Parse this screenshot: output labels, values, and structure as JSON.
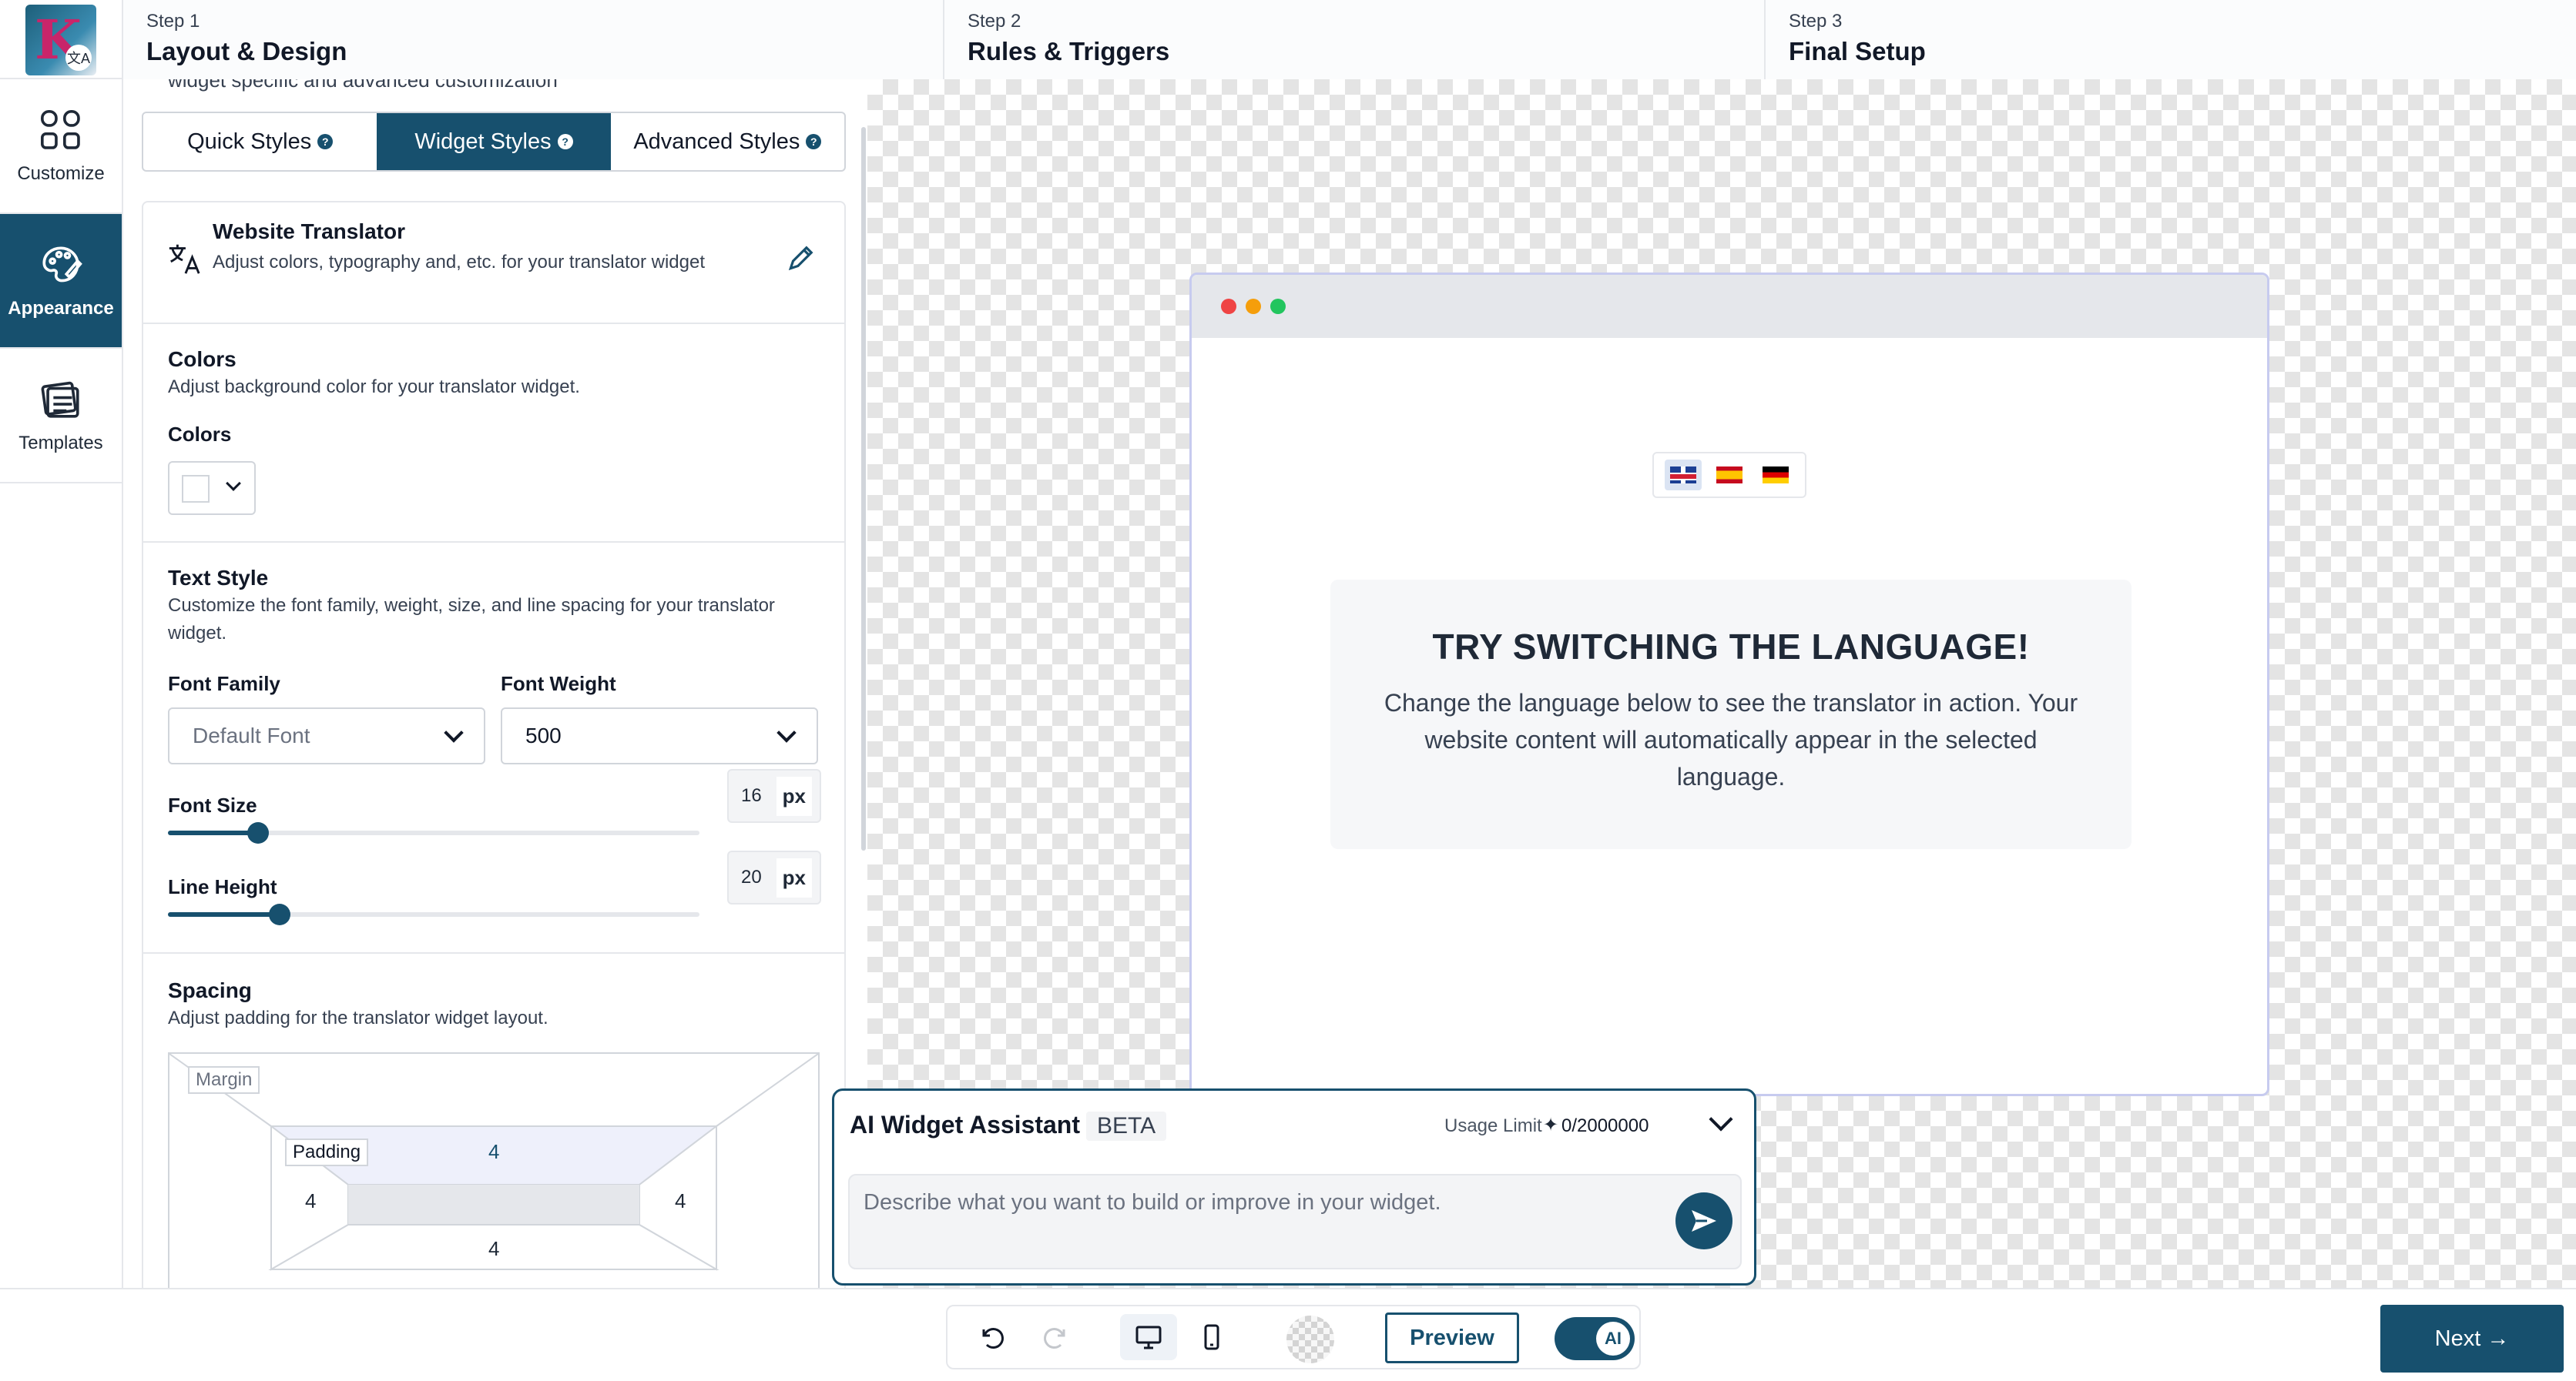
{
  "header": {
    "logo": {
      "letter": "K",
      "badge": "文A"
    },
    "steps": [
      {
        "num": "Step 1",
        "title": "Layout & Design"
      },
      {
        "num": "Step 2",
        "title": "Rules & Triggers"
      },
      {
        "num": "Step 3",
        "title": "Final Setup"
      }
    ]
  },
  "sidebar": {
    "items": [
      {
        "label": "Customize",
        "icon": "grid-icon",
        "active": false
      },
      {
        "label": "Appearance",
        "icon": "palette-icon",
        "active": true
      },
      {
        "label": "Templates",
        "icon": "templates-icon",
        "active": false
      }
    ]
  },
  "panel": {
    "cut_text": "widget specific and advanced customization",
    "tabs": [
      {
        "label": "Quick Styles",
        "active": false
      },
      {
        "label": "Widget Styles",
        "active": true
      },
      {
        "label": "Advanced Styles",
        "active": false
      }
    ],
    "widget": {
      "title": "Website Translator",
      "desc": "Adjust colors, typography and, etc. for your translator widget"
    },
    "colors": {
      "title": "Colors",
      "desc": "Adjust background color for your translator widget.",
      "label": "Colors",
      "value": "#ffffff"
    },
    "text_style": {
      "title": "Text Style",
      "desc": "Customize the font family, weight, size, and line spacing for your translator widget.",
      "font_family_label": "Font Family",
      "font_family_value": "Default Font",
      "font_weight_label": "Font Weight",
      "font_weight_value": "500",
      "font_size_label": "Font Size",
      "font_size_value": "16",
      "font_size_fraction": 0.17,
      "line_height_label": "Line Height",
      "line_height_value": "20",
      "line_height_fraction": 0.21,
      "unit": "px"
    },
    "spacing": {
      "title": "Spacing",
      "desc": "Adjust padding for the translator widget layout.",
      "margin_label": "Margin",
      "padding_label": "Padding",
      "padding_top": "4",
      "padding_left": "4",
      "padding_right": "4",
      "padding_bottom": "4"
    }
  },
  "preview": {
    "window_dots": [
      "#ef4444",
      "#f59e0b",
      "#22c55e"
    ],
    "flags": [
      "uk-flag-icon",
      "spain-flag-icon",
      "germany-flag-icon"
    ],
    "heading": "TRY SWITCHING THE LANGUAGE!",
    "body": "Change the language below to see the translator in action. Your website content will automatically appear in the selected language."
  },
  "ai_assistant": {
    "title": "AI Widget Assistant",
    "badge": "BETA",
    "usage_label": "Usage Limit",
    "usage_value": "0/2000000",
    "placeholder": "Describe what you want to build or improve in your widget."
  },
  "bottom": {
    "preview_label": "Preview",
    "toggle_label": "AI",
    "next_label": "Next →"
  },
  "colors": {
    "accent": "#17506e",
    "canvas_check": "#e4e4e4"
  }
}
